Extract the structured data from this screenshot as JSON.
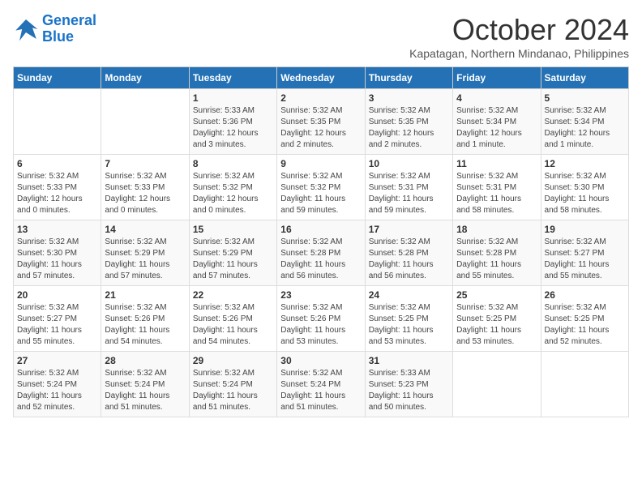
{
  "logo": {
    "line1": "General",
    "line2": "Blue"
  },
  "title": "October 2024",
  "subtitle": "Kapatagan, Northern Mindanao, Philippines",
  "headers": [
    "Sunday",
    "Monday",
    "Tuesday",
    "Wednesday",
    "Thursday",
    "Friday",
    "Saturday"
  ],
  "weeks": [
    [
      {
        "day": "",
        "info": ""
      },
      {
        "day": "",
        "info": ""
      },
      {
        "day": "1",
        "info": "Sunrise: 5:33 AM\nSunset: 5:36 PM\nDaylight: 12 hours\nand 3 minutes."
      },
      {
        "day": "2",
        "info": "Sunrise: 5:32 AM\nSunset: 5:35 PM\nDaylight: 12 hours\nand 2 minutes."
      },
      {
        "day": "3",
        "info": "Sunrise: 5:32 AM\nSunset: 5:35 PM\nDaylight: 12 hours\nand 2 minutes."
      },
      {
        "day": "4",
        "info": "Sunrise: 5:32 AM\nSunset: 5:34 PM\nDaylight: 12 hours\nand 1 minute."
      },
      {
        "day": "5",
        "info": "Sunrise: 5:32 AM\nSunset: 5:34 PM\nDaylight: 12 hours\nand 1 minute."
      }
    ],
    [
      {
        "day": "6",
        "info": "Sunrise: 5:32 AM\nSunset: 5:33 PM\nDaylight: 12 hours\nand 0 minutes."
      },
      {
        "day": "7",
        "info": "Sunrise: 5:32 AM\nSunset: 5:33 PM\nDaylight: 12 hours\nand 0 minutes."
      },
      {
        "day": "8",
        "info": "Sunrise: 5:32 AM\nSunset: 5:32 PM\nDaylight: 12 hours\nand 0 minutes."
      },
      {
        "day": "9",
        "info": "Sunrise: 5:32 AM\nSunset: 5:32 PM\nDaylight: 11 hours\nand 59 minutes."
      },
      {
        "day": "10",
        "info": "Sunrise: 5:32 AM\nSunset: 5:31 PM\nDaylight: 11 hours\nand 59 minutes."
      },
      {
        "day": "11",
        "info": "Sunrise: 5:32 AM\nSunset: 5:31 PM\nDaylight: 11 hours\nand 58 minutes."
      },
      {
        "day": "12",
        "info": "Sunrise: 5:32 AM\nSunset: 5:30 PM\nDaylight: 11 hours\nand 58 minutes."
      }
    ],
    [
      {
        "day": "13",
        "info": "Sunrise: 5:32 AM\nSunset: 5:30 PM\nDaylight: 11 hours\nand 57 minutes."
      },
      {
        "day": "14",
        "info": "Sunrise: 5:32 AM\nSunset: 5:29 PM\nDaylight: 11 hours\nand 57 minutes."
      },
      {
        "day": "15",
        "info": "Sunrise: 5:32 AM\nSunset: 5:29 PM\nDaylight: 11 hours\nand 57 minutes."
      },
      {
        "day": "16",
        "info": "Sunrise: 5:32 AM\nSunset: 5:28 PM\nDaylight: 11 hours\nand 56 minutes."
      },
      {
        "day": "17",
        "info": "Sunrise: 5:32 AM\nSunset: 5:28 PM\nDaylight: 11 hours\nand 56 minutes."
      },
      {
        "day": "18",
        "info": "Sunrise: 5:32 AM\nSunset: 5:28 PM\nDaylight: 11 hours\nand 55 minutes."
      },
      {
        "day": "19",
        "info": "Sunrise: 5:32 AM\nSunset: 5:27 PM\nDaylight: 11 hours\nand 55 minutes."
      }
    ],
    [
      {
        "day": "20",
        "info": "Sunrise: 5:32 AM\nSunset: 5:27 PM\nDaylight: 11 hours\nand 55 minutes."
      },
      {
        "day": "21",
        "info": "Sunrise: 5:32 AM\nSunset: 5:26 PM\nDaylight: 11 hours\nand 54 minutes."
      },
      {
        "day": "22",
        "info": "Sunrise: 5:32 AM\nSunset: 5:26 PM\nDaylight: 11 hours\nand 54 minutes."
      },
      {
        "day": "23",
        "info": "Sunrise: 5:32 AM\nSunset: 5:26 PM\nDaylight: 11 hours\nand 53 minutes."
      },
      {
        "day": "24",
        "info": "Sunrise: 5:32 AM\nSunset: 5:25 PM\nDaylight: 11 hours\nand 53 minutes."
      },
      {
        "day": "25",
        "info": "Sunrise: 5:32 AM\nSunset: 5:25 PM\nDaylight: 11 hours\nand 53 minutes."
      },
      {
        "day": "26",
        "info": "Sunrise: 5:32 AM\nSunset: 5:25 PM\nDaylight: 11 hours\nand 52 minutes."
      }
    ],
    [
      {
        "day": "27",
        "info": "Sunrise: 5:32 AM\nSunset: 5:24 PM\nDaylight: 11 hours\nand 52 minutes."
      },
      {
        "day": "28",
        "info": "Sunrise: 5:32 AM\nSunset: 5:24 PM\nDaylight: 11 hours\nand 51 minutes."
      },
      {
        "day": "29",
        "info": "Sunrise: 5:32 AM\nSunset: 5:24 PM\nDaylight: 11 hours\nand 51 minutes."
      },
      {
        "day": "30",
        "info": "Sunrise: 5:32 AM\nSunset: 5:24 PM\nDaylight: 11 hours\nand 51 minutes."
      },
      {
        "day": "31",
        "info": "Sunrise: 5:33 AM\nSunset: 5:23 PM\nDaylight: 11 hours\nand 50 minutes."
      },
      {
        "day": "",
        "info": ""
      },
      {
        "day": "",
        "info": ""
      }
    ]
  ]
}
